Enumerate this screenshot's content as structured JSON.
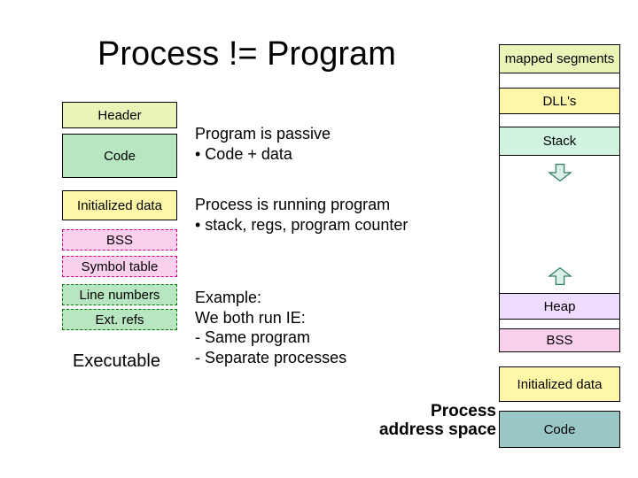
{
  "title": "Process != Program",
  "left": {
    "header": "Header",
    "code": "Code",
    "initialized_data": "Initialized data",
    "bss": "BSS",
    "symbol_table": "Symbol table",
    "line_numbers": "Line numbers",
    "ext_refs": "Ext. refs",
    "exec_label": "Executable"
  },
  "mid": {
    "program_passive_l1": "Program is passive",
    "program_passive_l2": "• Code + data",
    "process_running_l1": "Process is running program",
    "process_running_l2": "• stack, regs, program counter",
    "example_l1": "Example:",
    "example_l2": "We both run IE:",
    "example_l3": "- Same program",
    "example_l4": "- Separate processes"
  },
  "right": {
    "mapped": "mapped segments",
    "dlls": "DLL's",
    "stack": "Stack",
    "heap": "Heap",
    "bss": "BSS",
    "initialized_data": "Initialized data",
    "code": "Code"
  },
  "process_label_l1": "Process",
  "process_label_l2": "address space"
}
